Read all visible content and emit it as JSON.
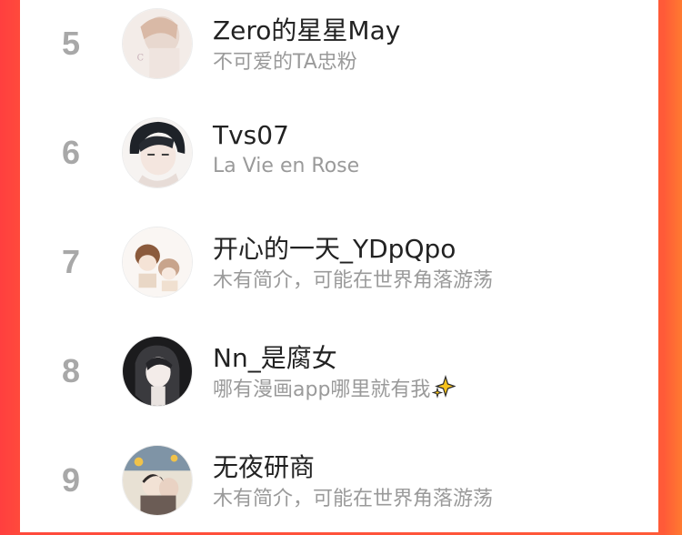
{
  "ranking": {
    "items": [
      {
        "rank": "5",
        "name": "Zero的星星May",
        "description": "不可爱的TA忠粉"
      },
      {
        "rank": "6",
        "name": "Tvs07",
        "description": "La Vie en Rose"
      },
      {
        "rank": "7",
        "name": "开心的一天_YDpQpo",
        "description": "木有简介，可能在世界角落游荡"
      },
      {
        "rank": "8",
        "name": "Nn_是腐女",
        "description": "哪有漫画app哪里就有我"
      },
      {
        "rank": "9",
        "name": "无夜研商",
        "description": "木有简介，可能在世界角落游荡"
      }
    ]
  },
  "icons": {
    "sparkle": "sparkles-icon"
  },
  "colors": {
    "accent_left": "#ff3f3f",
    "accent_right": "#ff7a30",
    "rank": "#a8a8a8"
  }
}
